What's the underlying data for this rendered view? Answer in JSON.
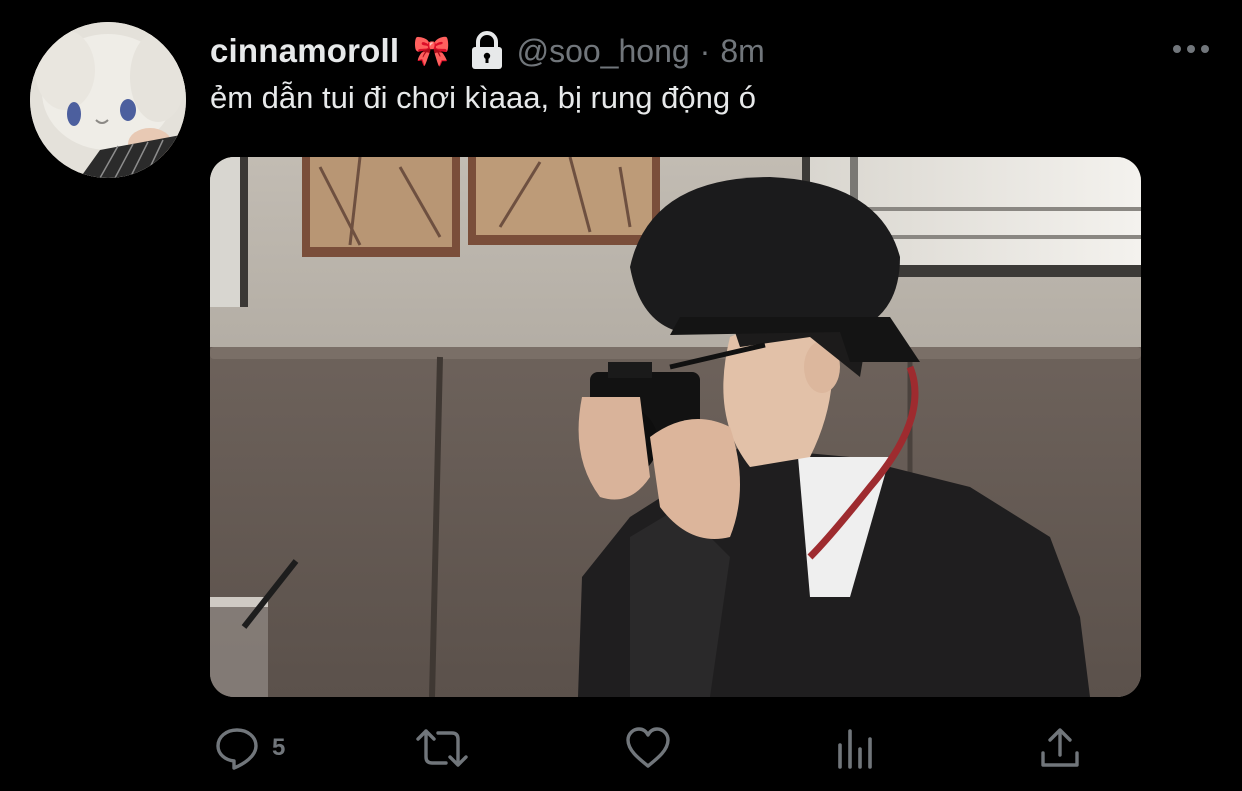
{
  "post": {
    "display_name": "cinnamoroll",
    "name_emoji": "🎀",
    "handle": "@soo_hong",
    "separator": "·",
    "time": "8m",
    "text": "ẻm dẫn tui đi chơi kìaaa, bị rung động ó",
    "locked": true
  },
  "actions": {
    "reply_count": "5",
    "retweet_count": "",
    "like_count": ""
  },
  "icons": {
    "reply": "reply-icon",
    "retweet": "retweet-icon",
    "like": "like-icon",
    "analytics": "analytics-icon",
    "share": "share-icon",
    "more": "more-icon",
    "lock": "lock-icon"
  },
  "colors": {
    "background": "#000000",
    "primary_text": "#e7e9ea",
    "secondary_text": "#71767b"
  }
}
